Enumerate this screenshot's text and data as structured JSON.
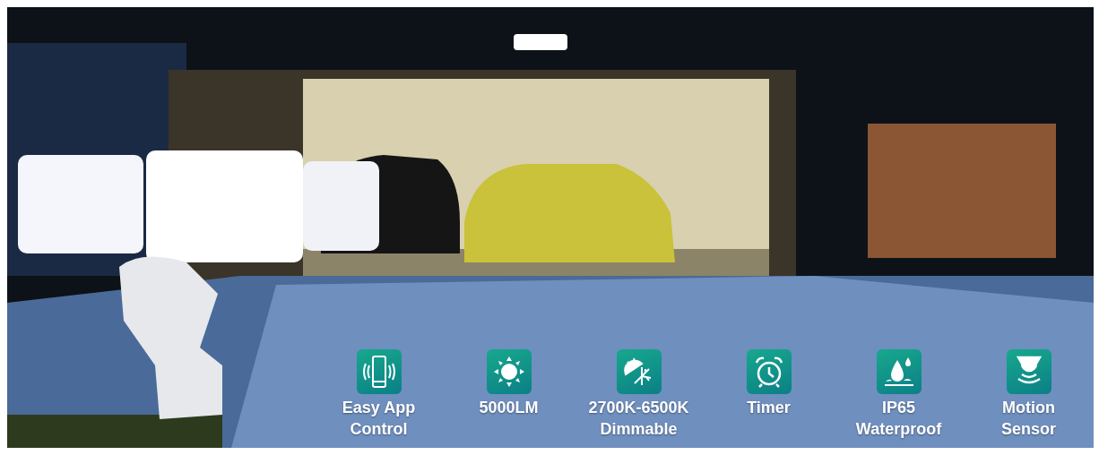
{
  "banner": {
    "kind": "picture",
    "features": [
      {
        "label": "Easy App\nControl"
      },
      {
        "label": "5000LM"
      },
      {
        "label": "2700K-6500K\nDimmable"
      },
      {
        "label": "Timer"
      },
      {
        "label": "IP65\nWaterproof"
      },
      {
        "label": "Motion\nSensor"
      }
    ]
  }
}
